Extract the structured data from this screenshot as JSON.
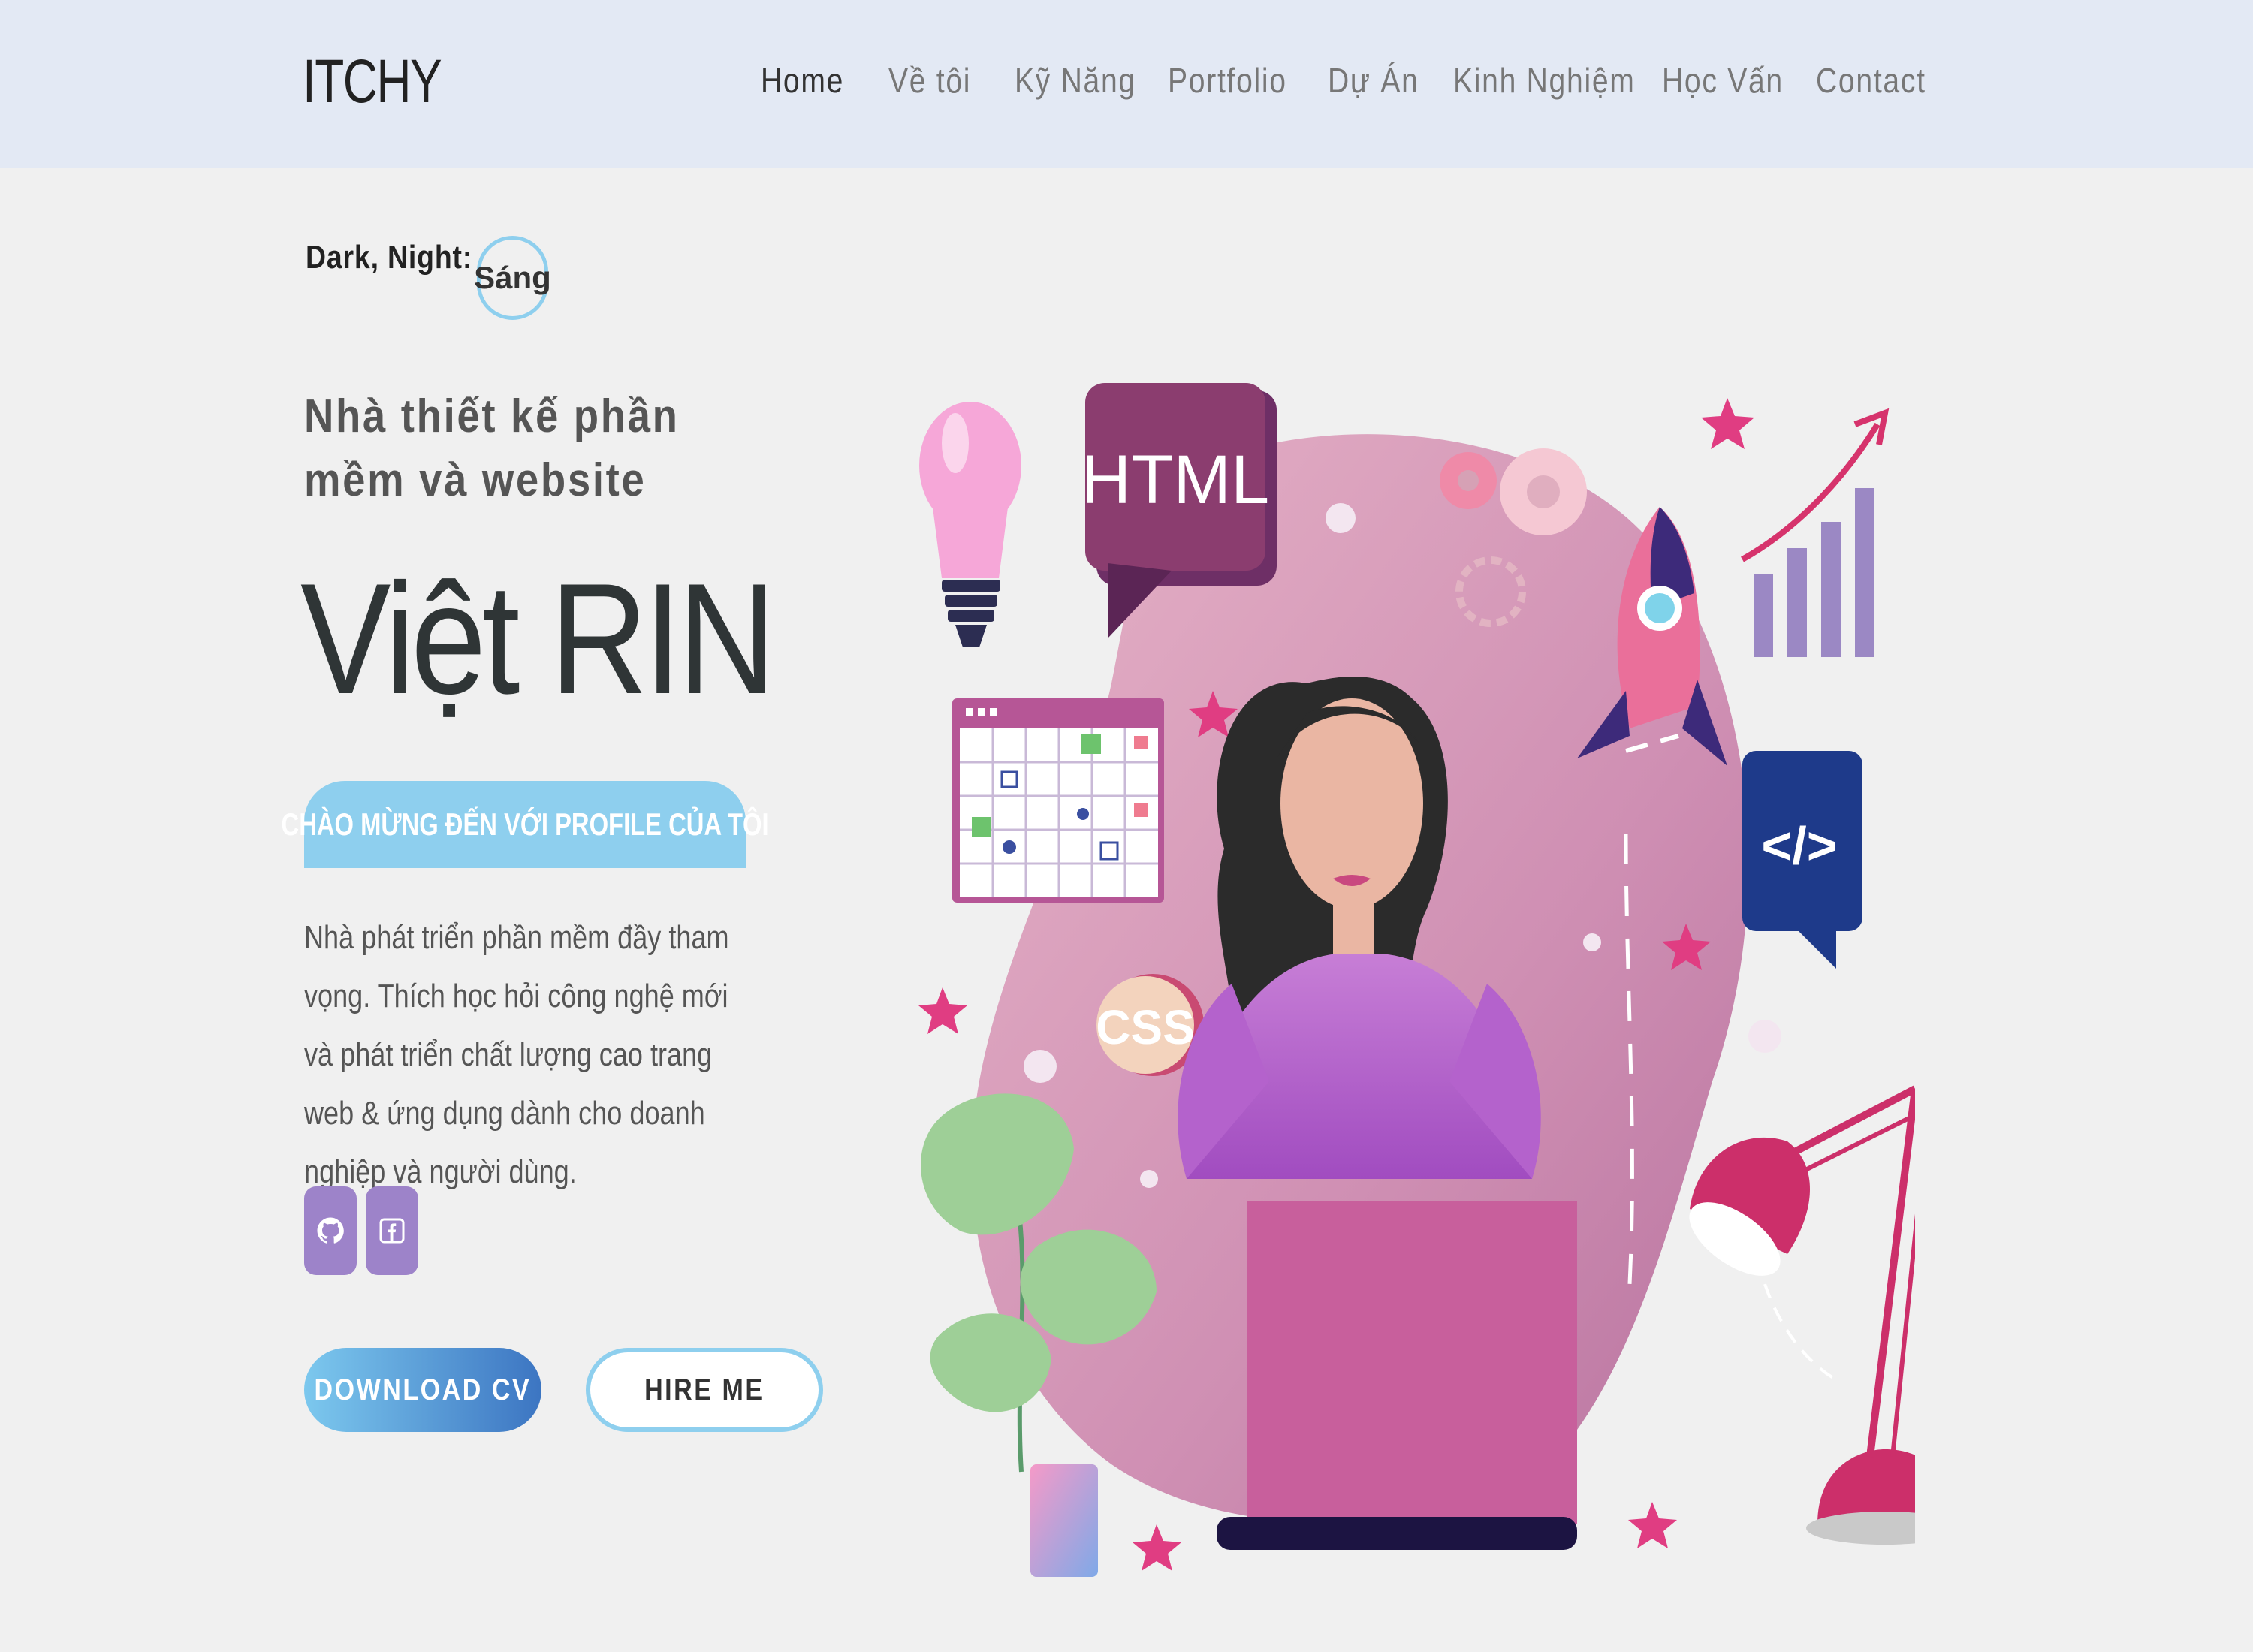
{
  "brand": "ITCHY",
  "nav": {
    "items": [
      {
        "label": "Home",
        "active": true
      },
      {
        "label": "Về tôi"
      },
      {
        "label": "Kỹ Năng"
      },
      {
        "label": "Portfolio"
      },
      {
        "label": "Dự Án"
      },
      {
        "label": "Kinh Nghiệm"
      },
      {
        "label": "Học Vấn"
      },
      {
        "label": "Contact"
      }
    ]
  },
  "theme": {
    "label": "Dark, Night:",
    "current": "Sáng"
  },
  "hero": {
    "subtitle": "Nhà thiết kế phần mềm và website",
    "name": "Việt RIN",
    "welcome": "CHÀO MỪNG ĐẾN VỚI PROFILE CỦA TÔI",
    "description": "Nhà phát triển phần mềm đầy tham vọng. Thích học hỏi công nghệ mới và phát triển chất lượng cao trang web & ứng dụng dành cho doanh nghiệp và người dùng.",
    "socials": [
      {
        "icon": "github-icon"
      },
      {
        "icon": "facebook-icon"
      }
    ],
    "download_label": "DOWNLOAD CV",
    "hire_label": "HIRE ME"
  },
  "illustration": {
    "html_label": "HTML",
    "css_label": "CSS",
    "code_label": "</>"
  },
  "colors": {
    "nav_bg": "#e3e9f4",
    "accent_blue": "#8ecfee",
    "social_purple": "#9d83c9",
    "blob_pink": "#d39bb8"
  }
}
